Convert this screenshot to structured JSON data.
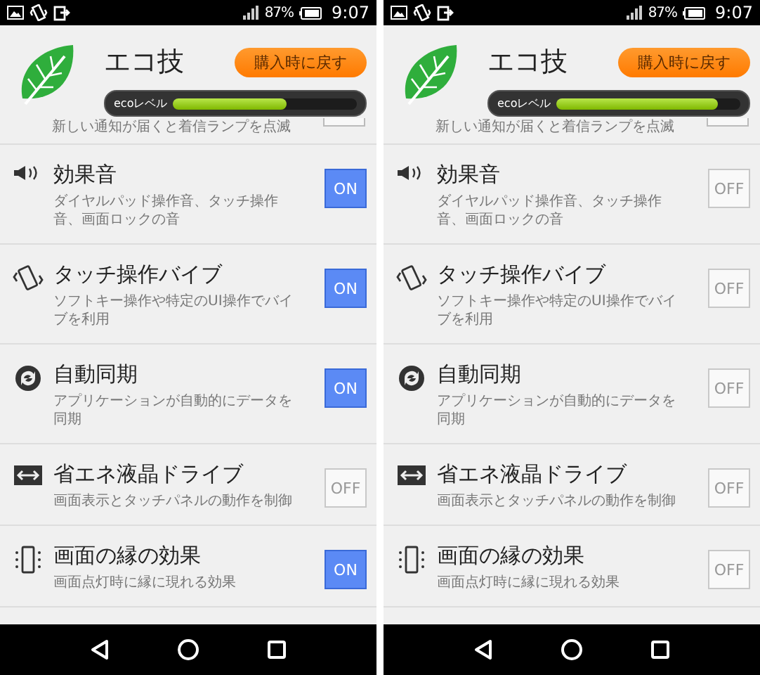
{
  "screens": [
    {
      "status_bar": {
        "battery_percent": "87%",
        "time": "9:07"
      },
      "header": {
        "title": "エコ技",
        "restore_button": "購入時に戻す",
        "eco_label": "ecoレベル",
        "level": 0.62
      },
      "partial_row": {
        "description": "新しい通知が届くと着信ランプを点滅",
        "on": false
      },
      "settings": [
        {
          "kind": "sound",
          "title": "効果音",
          "description": "ダイヤルパッド操作音、タッチ操作音、画面ロックの音",
          "on": true,
          "toggle_text": "ON"
        },
        {
          "kind": "vibrate",
          "title": "タッチ操作バイブ",
          "description": "ソフトキー操作や特定のUI操作でバイブを利用",
          "on": true,
          "toggle_text": "ON"
        },
        {
          "kind": "sync",
          "title": "自動同期",
          "description": "アプリケーションが自動的にデータを同期",
          "on": true,
          "toggle_text": "ON"
        },
        {
          "kind": "lcd",
          "title": "省エネ液晶ドライブ",
          "description": "画面表示とタッチパネルの動作を制御",
          "on": false,
          "toggle_text": "OFF"
        },
        {
          "kind": "edge",
          "title": "画面の縁の効果",
          "description": "画面点灯時に縁に現れる効果",
          "on": true,
          "toggle_text": "ON"
        }
      ]
    },
    {
      "status_bar": {
        "battery_percent": "87%",
        "time": "9:07"
      },
      "header": {
        "title": "エコ技",
        "restore_button": "購入時に戻す",
        "eco_label": "ecoレベル",
        "level": 0.88
      },
      "partial_row": {
        "description": "新しい通知が届くと着信ランプを点滅",
        "on": false
      },
      "settings": [
        {
          "kind": "sound",
          "title": "効果音",
          "description": "ダイヤルパッド操作音、タッチ操作音、画面ロックの音",
          "on": false,
          "toggle_text": "OFF"
        },
        {
          "kind": "vibrate",
          "title": "タッチ操作バイブ",
          "description": "ソフトキー操作や特定のUI操作でバイブを利用",
          "on": false,
          "toggle_text": "OFF"
        },
        {
          "kind": "sync",
          "title": "自動同期",
          "description": "アプリケーションが自動的にデータを同期",
          "on": false,
          "toggle_text": "OFF"
        },
        {
          "kind": "lcd",
          "title": "省エネ液晶ドライブ",
          "description": "画面表示とタッチパネルの動作を制御",
          "on": false,
          "toggle_text": "OFF"
        },
        {
          "kind": "edge",
          "title": "画面の縁の効果",
          "description": "画面点灯時に縁に現れる効果",
          "on": false,
          "toggle_text": "OFF"
        }
      ]
    }
  ]
}
